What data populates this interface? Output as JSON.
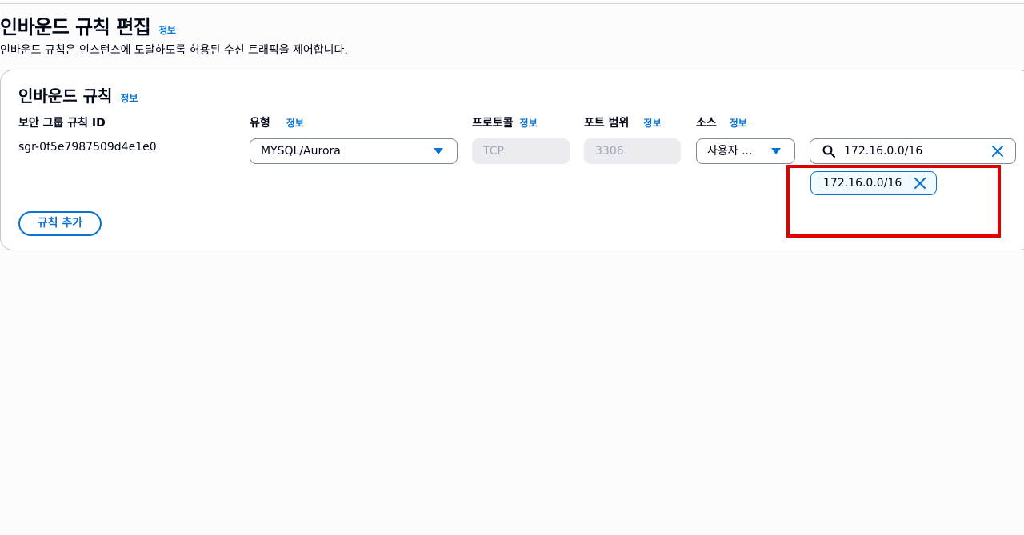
{
  "page": {
    "title": "인바운드 규칙 편집",
    "info_label": "정보",
    "description": "인바운드 규칙은 인스턴스에 도달하도록 허용된 수신 트래픽을 제어합니다."
  },
  "panel": {
    "title": "인바운드 규칙",
    "info_label": "정보",
    "columns": {
      "rule_id": "보안 그룹 규칙 ID",
      "type": "유형",
      "protocol": "프로토콜",
      "port_range": "포트 범위",
      "source": "소스"
    },
    "rule": {
      "id": "sgr-0f5e7987509d4e1e0",
      "type": "MYSQL/Aurora",
      "protocol": "TCP",
      "port_range": "3306",
      "source_type": "사용자 ...",
      "source_search_value": "172.16.0.0/16",
      "source_token": "172.16.0.0/16"
    },
    "add_rule_label": "규칙 추가"
  },
  "colors": {
    "accent": "#0972d3",
    "highlight": "#e00000",
    "disabled_bg": "#ebebf0",
    "token_bg": "#f0fbff"
  },
  "icons": {
    "type_caret": "caret-down-icon",
    "source_caret": "caret-down-icon",
    "search": "search-icon",
    "clear": "close-icon",
    "token_remove": "close-icon"
  }
}
